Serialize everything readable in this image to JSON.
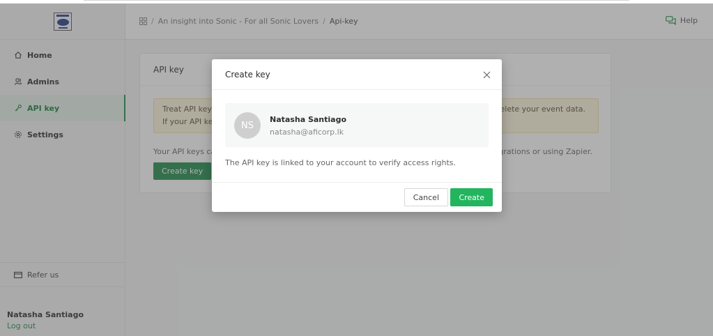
{
  "sidebar": {
    "items": [
      {
        "label": "Home",
        "icon": "home-icon"
      },
      {
        "label": "Admins",
        "icon": "admins-icon"
      },
      {
        "label": "API key",
        "icon": "key-icon"
      },
      {
        "label": "Settings",
        "icon": "gear-icon"
      }
    ],
    "refer_label": "Refer us",
    "user_name": "Natasha Santiago",
    "logout_label": "Log out"
  },
  "header": {
    "breadcrumb": [
      "An insight into Sonic - For all Sonic Lovers",
      "Api-key"
    ],
    "help_label": "Help"
  },
  "card": {
    "title": "API key",
    "warning_line1": "Treat API keys",
    "warning_line2": "If your API key",
    "warning_right": "delete your event data.",
    "desc_left": "Your API keys can",
    "desc_right": "ntegrations or using Zapier.",
    "create_button": "Create key"
  },
  "modal": {
    "title": "Create key",
    "user_initials": "NS",
    "user_name": "Natasha Santiago",
    "user_email": "natasha@aficorp.lk",
    "note": "The API key is linked to your account to verify access rights.",
    "cancel_label": "Cancel",
    "create_label": "Create"
  },
  "colors": {
    "accent": "#1f8a4c",
    "create_button": "#22b55e",
    "warning_bg": "#fdf6dc"
  }
}
